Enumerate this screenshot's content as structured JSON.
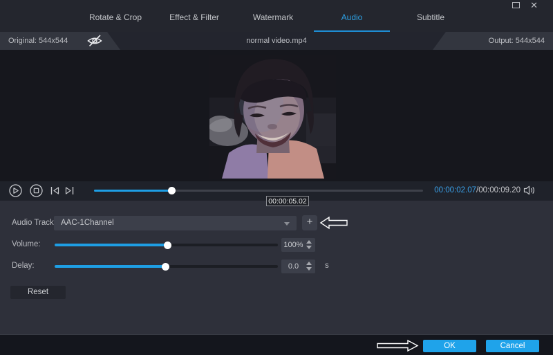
{
  "header": {
    "tabs": [
      {
        "label": "Rotate & Crop"
      },
      {
        "label": "Effect & Filter"
      },
      {
        "label": "Watermark"
      },
      {
        "label": "Audio"
      },
      {
        "label": "Subtitle"
      }
    ],
    "active_tab": "Audio",
    "window_controls": {
      "maximize": "maximize",
      "close": "✕"
    }
  },
  "info_bar": {
    "original": "Original: 544x544",
    "filename": "normal video.mp4",
    "output": "Output: 544x544"
  },
  "player": {
    "current_time": "00:00:02.07",
    "time_separator": "/",
    "duration": "00:00:09.20",
    "seek_tooltip": "00:00:05.02",
    "progress_percent": 23.5
  },
  "settings": {
    "audio_track": {
      "label": "Audio Track:",
      "selected": "AAC-1Channel"
    },
    "volume": {
      "label": "Volume:",
      "value": "100%",
      "slider_percent": 50.5
    },
    "delay": {
      "label": "Delay:",
      "value": "0.0",
      "unit": "s",
      "slider_percent": 49.5
    },
    "reset_label": "Reset"
  },
  "footer": {
    "ok_label": "OK",
    "cancel_label": "Cancel"
  },
  "icons": {
    "eye_off": "preview-hidden",
    "play": "play",
    "stop": "stop",
    "prev_frame": "previous-frame",
    "next_frame": "next-frame",
    "speaker": "volume",
    "plus": "+",
    "chevron_down": "dropdown-arrow",
    "annotation_left": "cursor-arrow-left",
    "annotation_right": "cursor-arrow-right"
  },
  "colors": {
    "accent_blue": "#1e9ee4",
    "button_blue": "#1fa3ea",
    "time_current_blue": "#3aa0e8",
    "panel_bg": "#2e303a",
    "header_bg": "#24262e",
    "stage_bg": "#16171d"
  }
}
